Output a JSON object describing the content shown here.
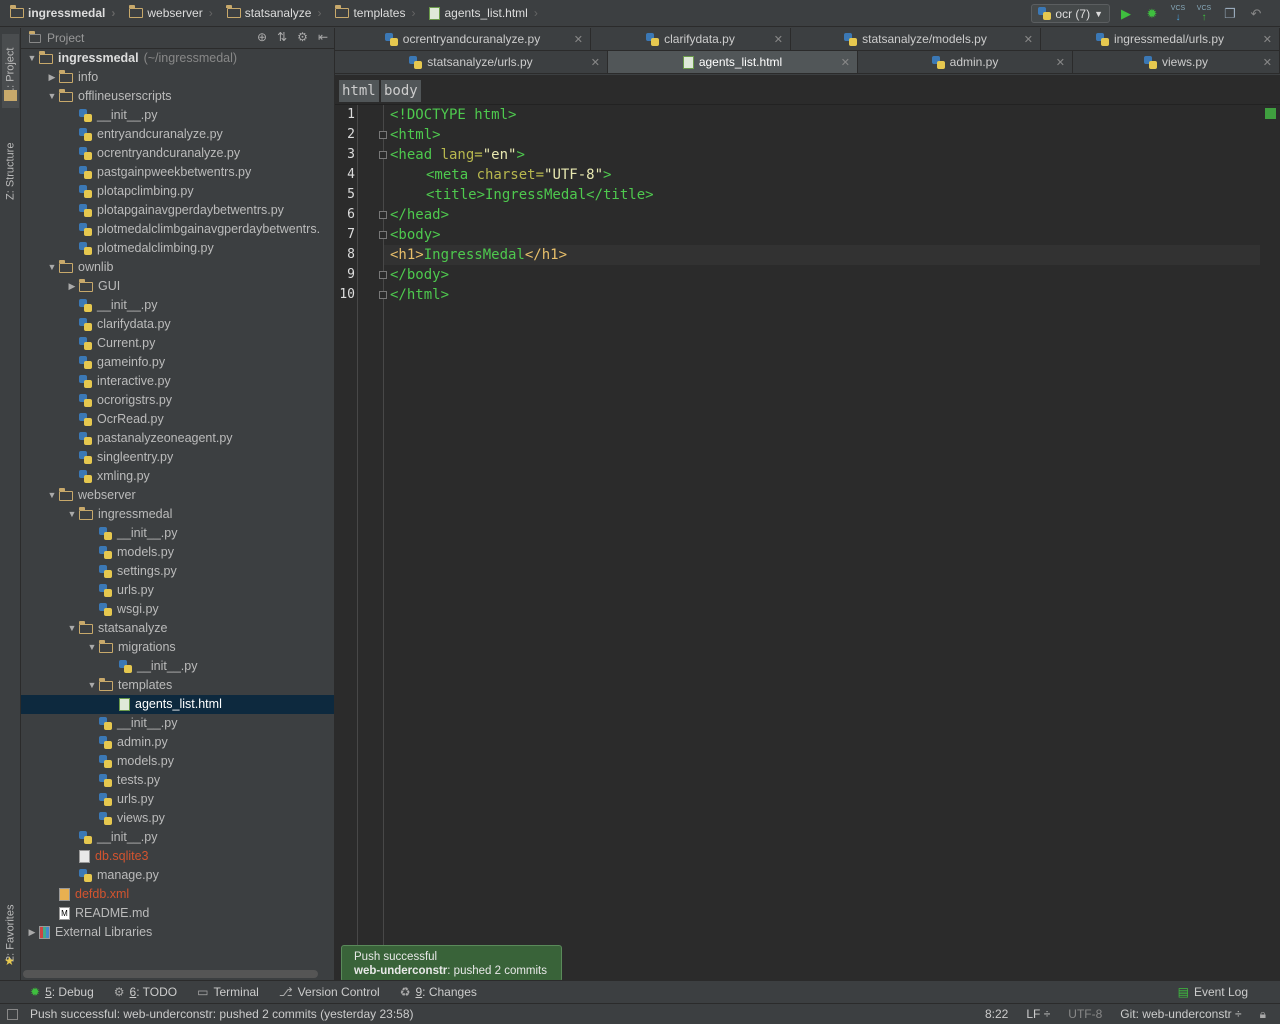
{
  "breadcrumb": [
    {
      "label": "ingressmedal",
      "type": "folder"
    },
    {
      "label": "webserver",
      "type": "folder"
    },
    {
      "label": "statsanalyze",
      "type": "folder"
    },
    {
      "label": "templates",
      "type": "folder"
    },
    {
      "label": "agents_list.html",
      "type": "html"
    }
  ],
  "run_config": {
    "label": "ocr (7)"
  },
  "toolbar": {
    "vcs1": "VCS",
    "vcs2": "VCS"
  },
  "side_tabs": {
    "project": "1: Project",
    "structure": "Z: Structure",
    "favorites": "2: Favorites"
  },
  "project_panel": {
    "title": "Project"
  },
  "tree": [
    {
      "label": "ingressmedal",
      "hint": "(~/ingressmedal)",
      "depth": 0,
      "arrow": "down",
      "icon": "folder",
      "root": true
    },
    {
      "label": "info",
      "depth": 1,
      "arrow": "right",
      "icon": "folder"
    },
    {
      "label": "offlineuserscripts",
      "depth": 1,
      "arrow": "down",
      "icon": "folder"
    },
    {
      "label": "__init__.py",
      "depth": 2,
      "icon": "py"
    },
    {
      "label": "entryandcuranalyze.py",
      "depth": 2,
      "icon": "py"
    },
    {
      "label": "ocrentryandcuranalyze.py",
      "depth": 2,
      "icon": "py"
    },
    {
      "label": "pastgainpweekbetwentrs.py",
      "depth": 2,
      "icon": "py"
    },
    {
      "label": "plotapclimbing.py",
      "depth": 2,
      "icon": "py"
    },
    {
      "label": "plotapgainavgperdaybetwentrs.py",
      "depth": 2,
      "icon": "py"
    },
    {
      "label": "plotmedalclimbgainavgperdaybetwentrs.",
      "depth": 2,
      "icon": "py"
    },
    {
      "label": "plotmedalclimbing.py",
      "depth": 2,
      "icon": "py"
    },
    {
      "label": "ownlib",
      "depth": 1,
      "arrow": "down",
      "icon": "folder"
    },
    {
      "label": "GUI",
      "depth": 2,
      "arrow": "right",
      "icon": "folder"
    },
    {
      "label": "__init__.py",
      "depth": 2,
      "icon": "py"
    },
    {
      "label": "clarifydata.py",
      "depth": 2,
      "icon": "py"
    },
    {
      "label": "Current.py",
      "depth": 2,
      "icon": "py"
    },
    {
      "label": "gameinfo.py",
      "depth": 2,
      "icon": "py"
    },
    {
      "label": "interactive.py",
      "depth": 2,
      "icon": "py"
    },
    {
      "label": "ocrorigstrs.py",
      "depth": 2,
      "icon": "py"
    },
    {
      "label": "OcrRead.py",
      "depth": 2,
      "icon": "py"
    },
    {
      "label": "pastanalyzeoneagent.py",
      "depth": 2,
      "icon": "py"
    },
    {
      "label": "singleentry.py",
      "depth": 2,
      "icon": "py"
    },
    {
      "label": "xmling.py",
      "depth": 2,
      "icon": "py"
    },
    {
      "label": "webserver",
      "depth": 1,
      "arrow": "down",
      "icon": "folder"
    },
    {
      "label": "ingressmedal",
      "depth": 2,
      "arrow": "down",
      "icon": "folder"
    },
    {
      "label": "__init__.py",
      "depth": 3,
      "icon": "py"
    },
    {
      "label": "models.py",
      "depth": 3,
      "icon": "py"
    },
    {
      "label": "settings.py",
      "depth": 3,
      "icon": "py"
    },
    {
      "label": "urls.py",
      "depth": 3,
      "icon": "py"
    },
    {
      "label": "wsgi.py",
      "depth": 3,
      "icon": "py"
    },
    {
      "label": "statsanalyze",
      "depth": 2,
      "arrow": "down",
      "icon": "folder"
    },
    {
      "label": "migrations",
      "depth": 3,
      "arrow": "down",
      "icon": "folder"
    },
    {
      "label": "__init__.py",
      "depth": 4,
      "icon": "py"
    },
    {
      "label": "templates",
      "depth": 3,
      "arrow": "down",
      "icon": "folder"
    },
    {
      "label": "agents_list.html",
      "depth": 4,
      "icon": "html",
      "selected": true
    },
    {
      "label": "__init__.py",
      "depth": 3,
      "icon": "py"
    },
    {
      "label": "admin.py",
      "depth": 3,
      "icon": "py"
    },
    {
      "label": "models.py",
      "depth": 3,
      "icon": "py"
    },
    {
      "label": "tests.py",
      "depth": 3,
      "icon": "py"
    },
    {
      "label": "urls.py",
      "depth": 3,
      "icon": "py"
    },
    {
      "label": "views.py",
      "depth": 3,
      "icon": "py"
    },
    {
      "label": "__init__.py",
      "depth": 2,
      "icon": "py"
    },
    {
      "label": "db.sqlite3",
      "depth": 2,
      "icon": "file",
      "error": true
    },
    {
      "label": "manage.py",
      "depth": 2,
      "icon": "py"
    },
    {
      "label": "defdb.xml",
      "depth": 1,
      "icon": "xml",
      "error": true
    },
    {
      "label": "README.md",
      "depth": 1,
      "icon": "md"
    },
    {
      "label": "External Libraries",
      "depth": 0,
      "arrow": "right",
      "icon": "lib"
    }
  ],
  "tabs_row1": [
    {
      "label": "ocrentryandcuranalyze.py"
    },
    {
      "label": "clarifydata.py"
    },
    {
      "label": "statsanalyze/models.py"
    },
    {
      "label": "ingressmedal/urls.py"
    }
  ],
  "tabs_row2": [
    {
      "label": "statsanalyze/urls.py"
    },
    {
      "label": "agents_list.html",
      "active": true
    },
    {
      "label": "admin.py"
    },
    {
      "label": "views.py"
    }
  ],
  "editor_breadcrumb": [
    "html",
    "body"
  ],
  "line_numbers": [
    "1",
    "2",
    "3",
    "4",
    "5",
    "6",
    "7",
    "8",
    "9",
    "10"
  ],
  "code": {
    "l1": "<!DOCTYPE html>",
    "l2": "<html>",
    "l3_tag": "<head ",
    "l3_attr": "lang=",
    "l3_val": "\"en\"",
    "l3_end": ">",
    "l4_tag": "<meta ",
    "l4_attr": "charset=",
    "l4_val": "\"UTF-8\"",
    "l4_end": ">",
    "l5": "<title>IngressMedal</title>",
    "l6": "</head>",
    "l7": "<body>",
    "l8_open": "<h1>",
    "l8_text": "IngressMedal",
    "l8_close": "</h1>",
    "l9": "</body>",
    "l10": "</html>"
  },
  "notification": {
    "title": "Push successful",
    "branch": "web-underconstr",
    "text": ": pushed 2 commits"
  },
  "tool_windows": [
    {
      "key": "5",
      "label": ": Debug"
    },
    {
      "key": "6",
      "label": ": TODO"
    },
    {
      "key": "",
      "label": "Terminal"
    },
    {
      "key": "",
      "label": "Version Control"
    },
    {
      "key": "9",
      "label": ": Changes"
    }
  ],
  "event_log": "Event Log",
  "status": {
    "message": "Push successful: web-underconstr: pushed 2 commits (yesterday 23:58)",
    "position": "8:22",
    "line_sep": "LF ÷",
    "encoding": "UTF-8",
    "vcs_branch": "Git: web-underconstr ÷"
  },
  "colors": {
    "selection": "#0d293e",
    "tag": "#4ec94e",
    "notification_bg": "#396339"
  }
}
